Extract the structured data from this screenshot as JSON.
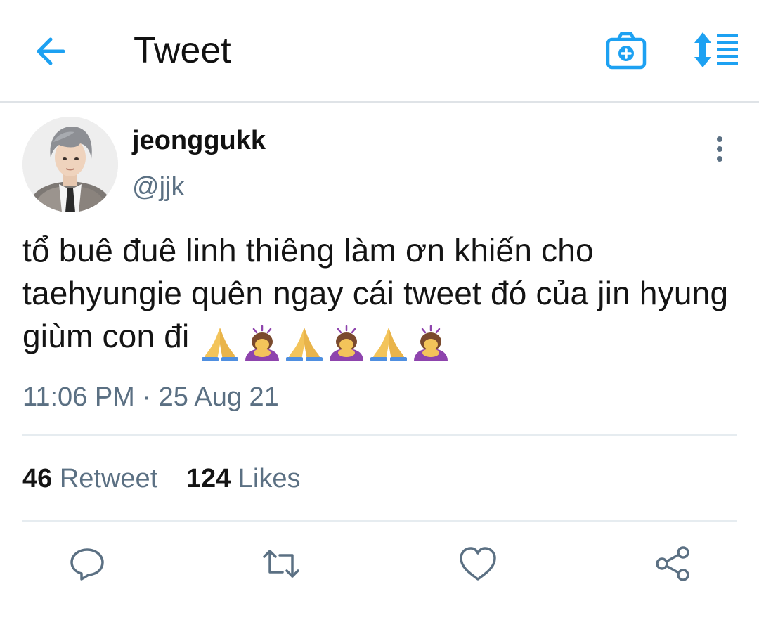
{
  "header": {
    "title": "Tweet",
    "back_icon": "arrow-left-icon",
    "camera_icon": "camera-add-icon",
    "sort_icon": "sort-toggle-icon",
    "accent_color": "#1da1f2"
  },
  "tweet": {
    "author": {
      "display_name": "jeonggukk",
      "handle": "@jjk"
    },
    "text": "tổ buê đuê linh thiêng làm ơn khiến cho taehyungie quên ngay cái tweet đó của jin hyung giùm con đi",
    "emojis": [
      "folded-hands",
      "person-bowing",
      "folded-hands",
      "person-bowing",
      "folded-hands",
      "person-bowing"
    ],
    "time": "11:06 PM",
    "separator": "·",
    "date": "25 Aug 21",
    "stats": {
      "retweets_count": "46",
      "retweets_label": "Retweet",
      "likes_count": "124",
      "likes_label": "Likes"
    },
    "actions": [
      "reply-icon",
      "retweet-icon",
      "like-icon",
      "share-icon"
    ]
  },
  "colors": {
    "text_primary": "#141414",
    "text_secondary": "#5b7083",
    "divider": "#e6ecf0"
  }
}
